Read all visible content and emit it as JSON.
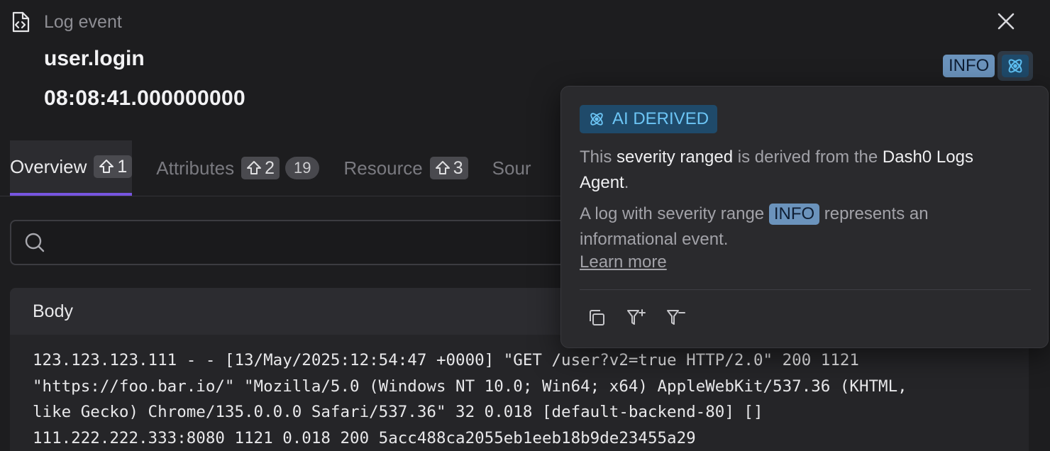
{
  "header": {
    "label": "Log event",
    "doc_icon": "code-document-icon",
    "close_icon": "close-icon"
  },
  "event": {
    "name": "user.login",
    "timestamp": "08:08:41.000000000",
    "severity": "INFO"
  },
  "tabs": [
    {
      "label": "Overview",
      "count": "1",
      "active": true
    },
    {
      "label": "Attributes",
      "count": "2",
      "pill": "19"
    },
    {
      "label": "Resource",
      "count": "3"
    },
    {
      "label": "Sour"
    }
  ],
  "search": {
    "placeholder": ""
  },
  "body": {
    "heading": "Body",
    "lines": [
      "123.123.123.111 - - [13/May/2025:12:54:47 +0000] \"GET /user?v2=true HTTP/2.0\" 200 1121",
      "\"https://foo.bar.io/\" \"Mozilla/5.0 (Windows NT 10.0; Win64; x64) AppleWebKit/537.36 (KHTML,",
      "like Gecko) Chrome/135.0.0.0 Safari/537.36\" 32 0.018 [default-backend-80] []",
      "111.222.222.333:8080 1121 0.018 200 5acc488ca2055eb1eeb18b9de23455a29"
    ]
  },
  "popover": {
    "badge": "AI DERIVED",
    "line1_a": "This ",
    "line1_b": "severity ranged",
    "line1_c": " is derived from the ",
    "line1_d": "Dash0 Logs Agent",
    "line1_e": ".",
    "line2_a": "A log with severity range ",
    "line2_badge": "INFO",
    "line2_b": " represents an informational event.",
    "learn_more": "Learn more",
    "actions": [
      "copy-icon",
      "filter-add-icon",
      "filter-remove-icon"
    ]
  },
  "colors": {
    "accent": "#7755e0",
    "info_badge": "#6b93bc",
    "ai_text": "#6cc5f5",
    "ai_bg": "#1f4a6a"
  }
}
